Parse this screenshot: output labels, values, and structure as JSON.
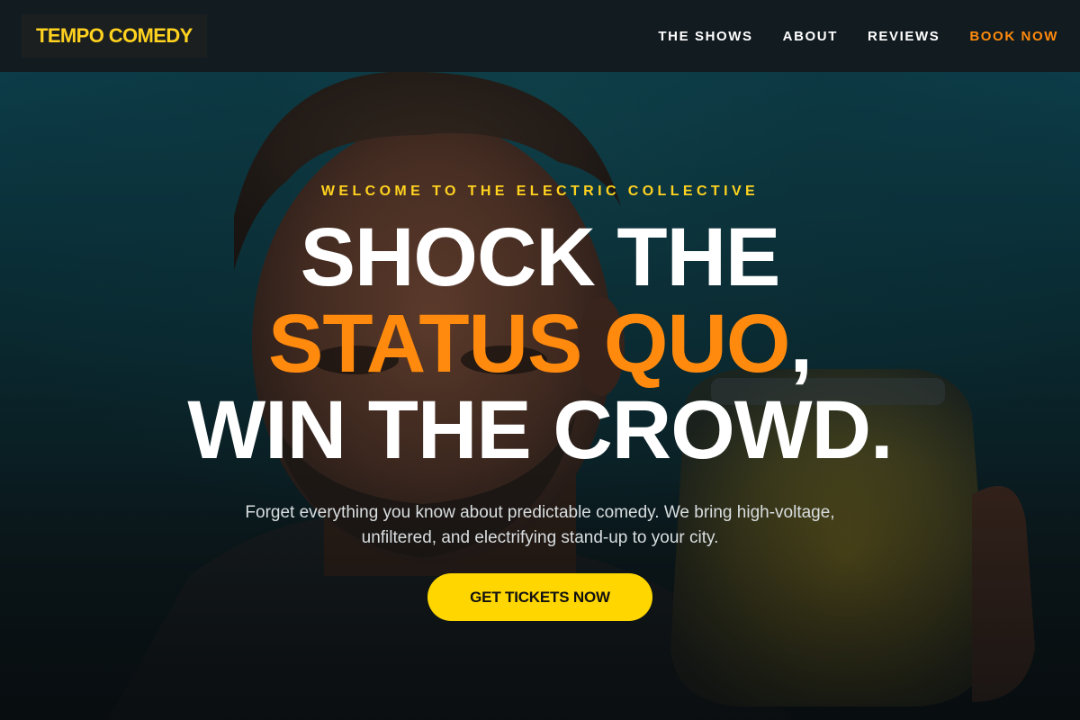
{
  "nav": {
    "logo": "TEMPO COMEDY",
    "links": [
      {
        "label": "THE SHOWS"
      },
      {
        "label": "ABOUT"
      },
      {
        "label": "REVIEWS"
      },
      {
        "label": "BOOK NOW"
      }
    ]
  },
  "hero": {
    "eyebrow": "WELCOME TO THE ELECTRIC COLLECTIVE",
    "headline_line1": "SHOCK THE",
    "headline_accent": "STATUS QUO",
    "headline_comma": ",",
    "headline_line3": "WIN THE CROWD.",
    "subtitle": "Forget everything you know about predictable comedy. We bring high-voltage, unfiltered, and electrifying stand-up to your city.",
    "cta": "GET TICKETS NOW"
  },
  "colors": {
    "brand_yellow": "#ffd21f",
    "accent_orange": "#ff8a0d",
    "nav_bg": "#121b1f",
    "hero_teal": "#0c4452"
  }
}
